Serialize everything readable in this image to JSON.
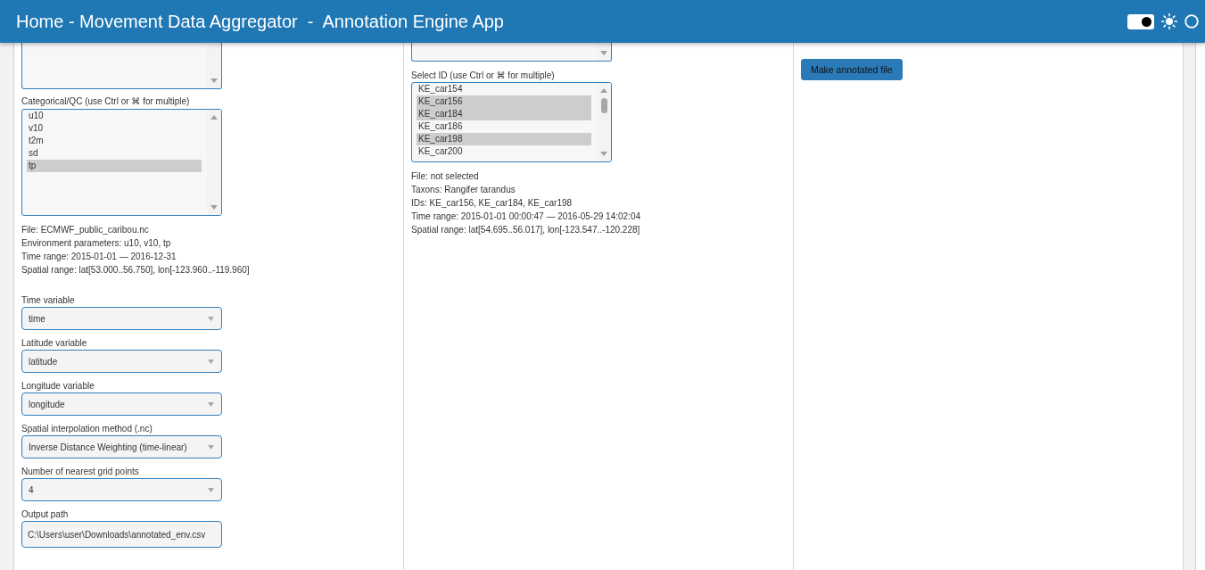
{
  "header": {
    "title": "Home - Movement Data Aggregator  -  Annotation Engine App",
    "theme_switch": {
      "on": true
    }
  },
  "environment_panel": {
    "qc_list": {
      "label": "Categorical/QC (use Ctrl or ⌘ for multiple)",
      "options": [
        {
          "label": "u10",
          "selected": false
        },
        {
          "label": "v10",
          "selected": false
        },
        {
          "label": "t2m",
          "selected": false
        },
        {
          "label": "sd",
          "selected": false
        },
        {
          "label": "tp",
          "selected": true
        }
      ]
    },
    "info": [
      "File: ECMWF_public_caribou.nc",
      "Environment parameters: u10, v10, tp",
      "Time range: 2015-01-01 — 2016-12-31",
      "Spatial range: lat[53.000..56.750], lon[-123.960..-119.960]"
    ],
    "fields": [
      {
        "kind": "select",
        "label": "Time variable",
        "value": "time"
      },
      {
        "kind": "select",
        "label": "Latitude variable",
        "value": "latitude"
      },
      {
        "kind": "select",
        "label": "Longitude variable",
        "value": "longitude"
      },
      {
        "kind": "select",
        "label": "Spatial interpolation method (.nc)",
        "value": "Inverse Distance Weighting (time-linear)"
      },
      {
        "kind": "select",
        "label": "Number of nearest grid points",
        "value": "4"
      },
      {
        "kind": "text",
        "label": "Output path",
        "value": "C:\\Users\\user\\Downloads\\annotated_env.csv"
      }
    ]
  },
  "movement_panel": {
    "id_list": {
      "label": "Select ID (use Ctrl or ⌘ for multiple)",
      "options": [
        {
          "label": "KE_car154",
          "selected": false
        },
        {
          "label": "KE_car156",
          "selected": true
        },
        {
          "label": "KE_car184",
          "selected": true
        },
        {
          "label": "KE_car186",
          "selected": false
        },
        {
          "label": "KE_car198",
          "selected": true
        },
        {
          "label": "KE_car200",
          "selected": false
        }
      ]
    },
    "info": [
      "File: not selected",
      "Taxons: Rangifer tarandus",
      "IDs: KE_car156, KE_car184, KE_car198",
      "Time range: 2015-01-01 00:00:47 — 2016-05-29 14:02:04",
      "Spatial range: lat[54.695..56.017], lon[-123.547..-120.228]"
    ]
  },
  "action_panel": {
    "button": "Make annotated file"
  }
}
